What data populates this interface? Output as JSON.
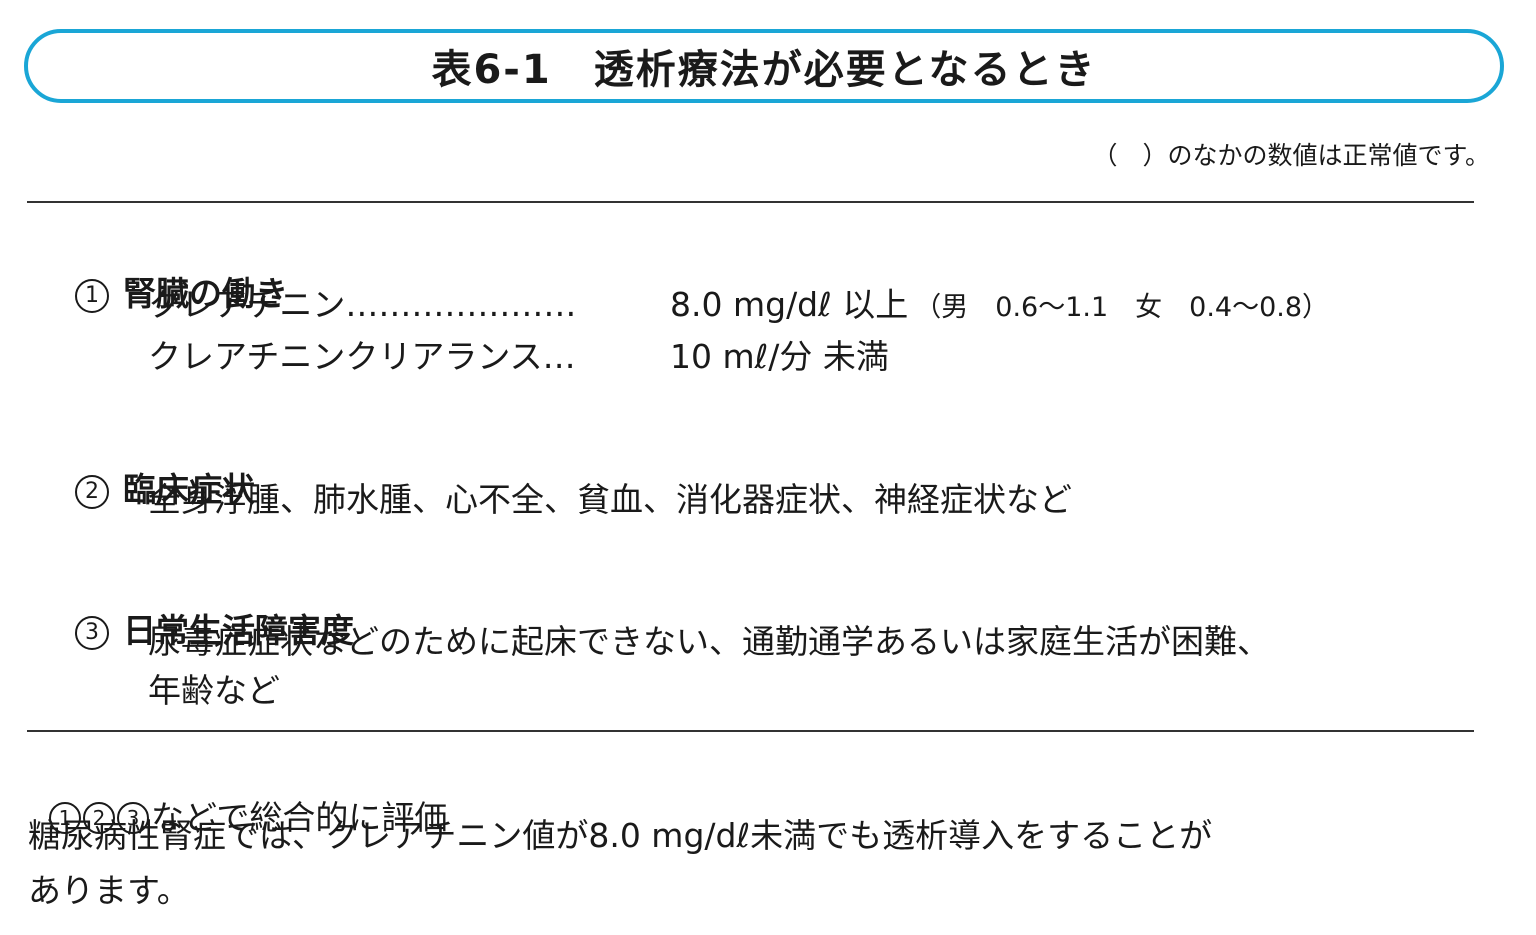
{
  "title": "表6-1　透析療法が必要となるとき",
  "note": "（　）のなかの数値は正常値です。",
  "sections": [
    {
      "number": "1",
      "heading": "腎臓の働き",
      "rows": [
        {
          "label": "クレアチニン…………………",
          "value": "8.0 mg/dℓ 以上",
          "normal": "（男　0.6〜1.1　女　0.4〜0.8）"
        },
        {
          "label": "クレアチニンクリアランス…",
          "value": "10 mℓ/分 未満"
        }
      ]
    },
    {
      "number": "2",
      "heading": "臨床症状",
      "lines": [
        "全身浮腫、肺水腫、心不全、貧血、消化器症状、神経症状など"
      ]
    },
    {
      "number": "3",
      "heading": "日常生活障害度",
      "lines": [
        "尿毒症症状などのために起床できない、通勤通学あるいは家庭生活が困難、",
        "年齢など"
      ]
    }
  ],
  "footer": {
    "marks": [
      "1",
      "2",
      "3"
    ],
    "line1_rest": "などで総合的に評価",
    "line2": "糖尿病性腎症では、クレアチニン値が8.0 mg/dℓ未満でも透析導入をすることが",
    "line3": "あります。"
  }
}
